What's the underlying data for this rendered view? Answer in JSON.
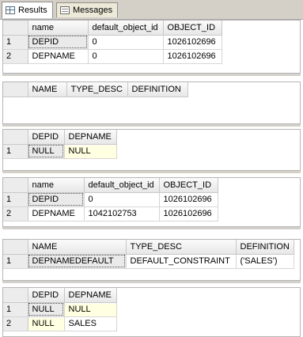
{
  "tabs": [
    {
      "label": "Results",
      "icon": "grid-icon"
    },
    {
      "label": "Messages",
      "icon": "messages-icon"
    }
  ],
  "results": [
    {
      "columns": [
        "name",
        "default_object_id",
        "OBJECT_ID"
      ],
      "rows": [
        [
          "1",
          "DEPID",
          "0",
          "1026102696"
        ],
        [
          "2",
          "DEPNAME",
          "0",
          "1026102696"
        ]
      ]
    },
    {
      "columns": [
        "NAME",
        "TYPE_DESC",
        "DEFINITION"
      ],
      "rows": []
    },
    {
      "columns": [
        "DEPID",
        "DEPNAME"
      ],
      "rows": [
        [
          "1",
          "NULL",
          "NULL"
        ]
      ]
    },
    {
      "columns": [
        "name",
        "default_object_id",
        "OBJECT_ID"
      ],
      "rows": [
        [
          "1",
          "DEPID",
          "0",
          "1026102696"
        ],
        [
          "2",
          "DEPNAME",
          "1042102753",
          "1026102696"
        ]
      ]
    },
    {
      "columns": [
        "NAME",
        "TYPE_DESC",
        "DEFINITION"
      ],
      "rows": [
        [
          "1",
          "DEPNAMEDEFAULT",
          "DEFAULT_CONSTRAINT",
          "('SALES')"
        ]
      ]
    },
    {
      "columns": [
        "DEPID",
        "DEPNAME"
      ],
      "rows": [
        [
          "1",
          "NULL",
          "NULL"
        ],
        [
          "2",
          "NULL",
          "SALES"
        ]
      ]
    }
  ],
  "colors": {
    "null_cell": "#ffffe1",
    "header": "#ececec",
    "background": "#d4d0c8"
  }
}
